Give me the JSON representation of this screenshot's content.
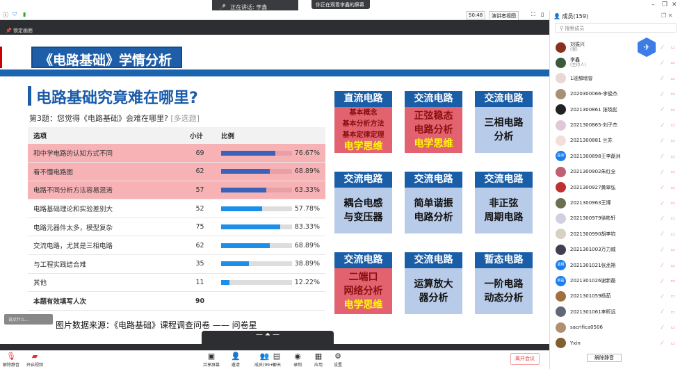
{
  "meeting": {
    "speaking": "正在讲话: 李鑫",
    "watching": "你正在观看李鑫的屏幕",
    "timer": "50:48",
    "view": "演讲者视图",
    "lock": "锁定画面"
  },
  "slide": {
    "title": "《电路基础》学情分析",
    "subtitle": "电路基础究竟难在哪里?",
    "question": "第3题：您觉得《电路基础》会难在哪里?",
    "question_tag": "[多选题]",
    "headers": [
      "选项",
      "小计",
      "比例"
    ],
    "rows": [
      {
        "option": "和中学电路的认知方式不同",
        "count": "69",
        "pct": "76.67%",
        "value": 76.67,
        "hl": true
      },
      {
        "option": "看不懂电路图",
        "count": "62",
        "pct": "68.89%",
        "value": 68.89,
        "hl": true
      },
      {
        "option": "电路不同分析方法容易混淆",
        "count": "57",
        "pct": "63.33%",
        "value": 63.33,
        "hl": true
      },
      {
        "option": "电路基础理论和实验差别大",
        "count": "52",
        "pct": "57.78%",
        "value": 57.78
      },
      {
        "option": "电路元器件太多，模型复杂",
        "count": "75",
        "pct": "83.33%",
        "value": 83.33
      },
      {
        "option": "交流电路，尤其是三相电路",
        "count": "62",
        "pct": "68.89%",
        "value": 68.89
      },
      {
        "option": "与工程实践结合难",
        "count": "35",
        "pct": "38.89%",
        "value": 38.89
      },
      {
        "option": "其他",
        "count": "11",
        "pct": "12.22%",
        "value": 12.22
      }
    ],
    "total_label": "本题有效填写人次",
    "total": "90",
    "cards": [
      {
        "h": "直流电路",
        "lines": [
          "基本概念",
          "基本分析方法",
          "基本定律定理"
        ],
        "tag": "电学思维",
        "red": true,
        "small": true
      },
      {
        "h": "交流电路",
        "lines": [
          "正弦稳态",
          "电路分析"
        ],
        "tag": "电学思维",
        "red": true
      },
      {
        "h": "交流电路",
        "lines": [
          "三相电路",
          "分析"
        ]
      },
      {
        "h": "交流电路",
        "lines": [
          "耦合电感",
          "与变压器"
        ]
      },
      {
        "h": "交流电路",
        "lines": [
          "简单谐振",
          "电路分析"
        ]
      },
      {
        "h": "交流电路",
        "lines": [
          "非正弦",
          "周期电路"
        ]
      },
      {
        "h": "交流电路",
        "lines": [
          "二端口",
          "网络分析"
        ],
        "tag": "电学思维",
        "red": true
      },
      {
        "h": "交流电路",
        "lines": [
          "运算放大",
          "器分析"
        ]
      },
      {
        "h": "暂态电路",
        "lines": [
          "一阶电路",
          "动态分析"
        ]
      }
    ],
    "source": "图片数据来源：《电路基础》课程调查问卷 —— 问卷星",
    "chat_placeholder": "说点什么..."
  },
  "toolbar": {
    "left": [
      {
        "label": "解除静音",
        "icon": "mic-off"
      },
      {
        "label": "开启视频",
        "icon": "camera-off"
      }
    ],
    "center": [
      {
        "label": "共享屏幕",
        "icon": "screen"
      },
      {
        "label": "邀请",
        "icon": "invite"
      },
      {
        "label": "成员(99+)",
        "icon": "members"
      },
      {
        "label": "聊天",
        "icon": "chat"
      },
      {
        "label": "录制",
        "icon": "record"
      },
      {
        "label": "应用",
        "icon": "apps"
      },
      {
        "label": "设置",
        "icon": "gear"
      }
    ],
    "leave": "离开会议"
  },
  "panel": {
    "title": "成员(159)",
    "search": "搜索成员",
    "unmute_all": "解除静音",
    "members": [
      {
        "name": "刘振兴",
        "role": "(我)",
        "color": "#8a3020"
      },
      {
        "name": "李鑫",
        "role": "(主持人)",
        "color": "#3a5a3a"
      },
      {
        "name": "1班郝增曾",
        "color": "#e8d8d8"
      },
      {
        "name": "2020300066-李俊杰",
        "color": "#a89078"
      },
      {
        "name": "2021300861 张晓彪",
        "color": "#222"
      },
      {
        "name": "2021300865-刘子杰",
        "color": "#e0c8d8"
      },
      {
        "name": "2021300881 兰苏",
        "color": "#f0e0d8"
      },
      {
        "name": "2021300898王李磊洲",
        "color": "#1a7ff0",
        "initials": "磊洲"
      },
      {
        "name": "2021300902朱红全",
        "color": "#c06070"
      },
      {
        "name": "2021300927黄翠弘",
        "color": "#c03030"
      },
      {
        "name": "2021300963王博",
        "color": "#6a7050"
      },
      {
        "name": "2021300979徐彬轩",
        "color": "#d0d0e0"
      },
      {
        "name": "2021300990胡李钧",
        "color": "#d8d0c0"
      },
      {
        "name": "2021301003万力威",
        "color": "#404050"
      },
      {
        "name": "2021301021张孟翔",
        "color": "#1a7ff0",
        "initials": "孟翔"
      },
      {
        "name": "2021301026谢新磊",
        "color": "#1a7ff0",
        "initials": "新磊"
      },
      {
        "name": "2021301059杨茹",
        "color": "#a07040"
      },
      {
        "name": "2021301061李昕远",
        "color": "#606878"
      },
      {
        "name": "sacrifica0506",
        "color": "#b09070"
      },
      {
        "name": "Yxin",
        "color": "#806030"
      }
    ]
  }
}
